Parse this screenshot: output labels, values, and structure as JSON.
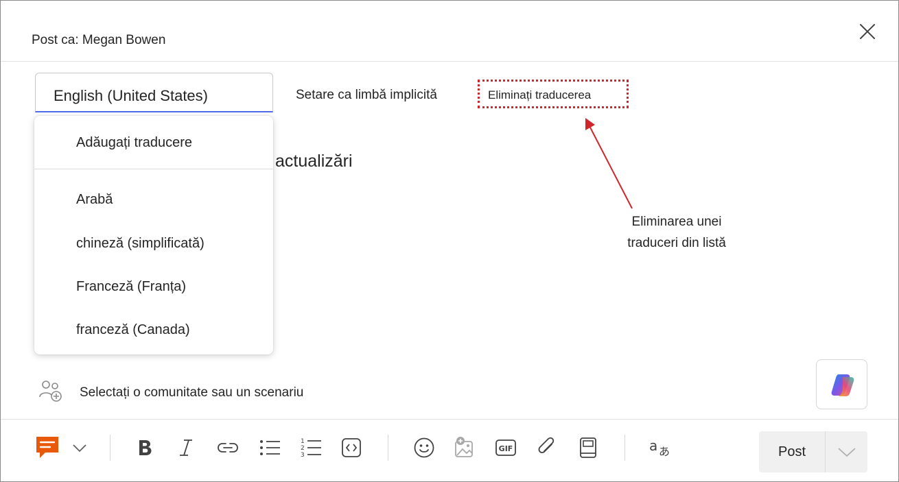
{
  "header": {
    "post_as": "Post ca: Megan Bowen"
  },
  "language_bar": {
    "selected_language": "English (United States)",
    "set_default": "Setare ca limbă implicită",
    "remove_translation": "Eliminați traducerea"
  },
  "dropdown": {
    "add_translation": "Adăugați traducere",
    "items": [
      "Arabă",
      "chineză (simplificată)",
      "Franceză (Franța)",
      "franceză (Canada)"
    ]
  },
  "content": {
    "partial_title": "actualizări"
  },
  "annotation": {
    "text": "Eliminarea unei traduceri din listă",
    "color": "#d0262b"
  },
  "community": {
    "label": "Selectați o comunitate sau un scenariu"
  },
  "toolbar": {
    "post_label": "Post",
    "icons": [
      "message-type-icon",
      "chevron-down-icon",
      "bold-icon",
      "italic-icon",
      "link-icon",
      "bullet-list-icon",
      "numbered-list-icon",
      "code-icon",
      "emoji-icon",
      "image-icon",
      "gif-icon",
      "attachment-icon",
      "book-icon",
      "translate-icon"
    ],
    "gif_text": "GIF",
    "accent_color": "#e8590c"
  }
}
